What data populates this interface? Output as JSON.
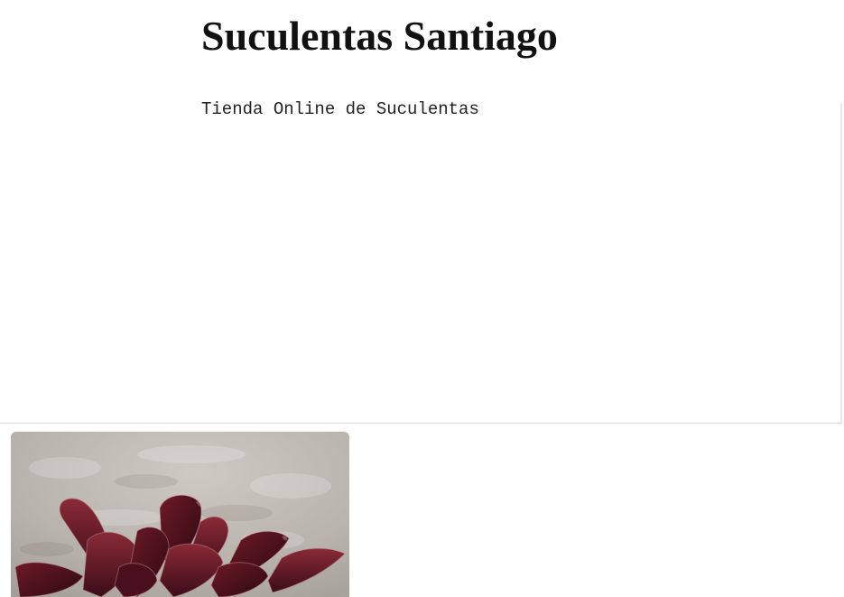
{
  "site": {
    "title": "Suculentas Santiago",
    "tagline": "Tienda Online de Suculentas"
  },
  "product_image": {
    "icon": "succulent-photo",
    "subject": "Suculenta roja"
  },
  "colors": {
    "background": "#ffffff",
    "divider": "#dcdcdc",
    "title_text": "#111111",
    "photo_wall": "#b8b2ad",
    "leaf_dark": "#3a0f1a",
    "leaf_red": "#7a1e2c"
  }
}
